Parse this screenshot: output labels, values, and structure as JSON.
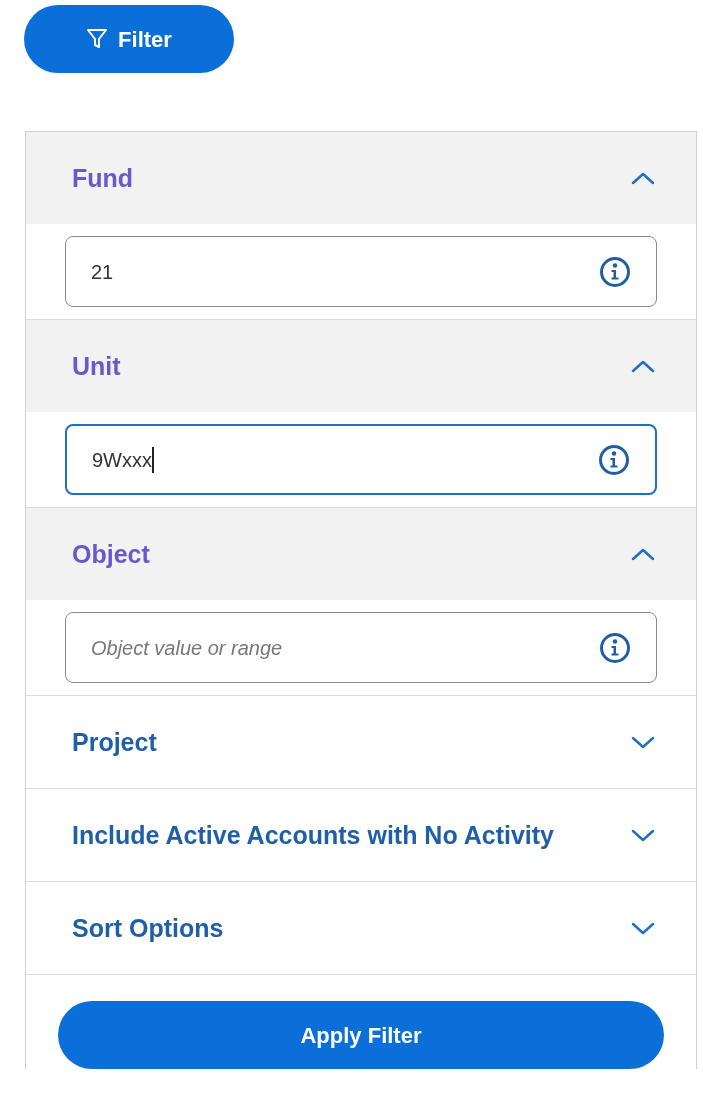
{
  "filter_button": {
    "label": "Filter"
  },
  "sections": [
    {
      "title": "Fund",
      "expanded": true,
      "field": {
        "value": "21",
        "focused": false
      }
    },
    {
      "title": "Unit",
      "expanded": true,
      "field": {
        "value": "9Wxxx",
        "focused": true
      }
    },
    {
      "title": "Object",
      "expanded": true,
      "field": {
        "placeholder": "Object value or range",
        "focused": false
      }
    },
    {
      "title": "Project",
      "expanded": false
    },
    {
      "title": "Include Active Accounts with No Activity",
      "expanded": false
    },
    {
      "title": "Sort Options",
      "expanded": false
    }
  ],
  "apply_button": {
    "label": "Apply Filter"
  }
}
